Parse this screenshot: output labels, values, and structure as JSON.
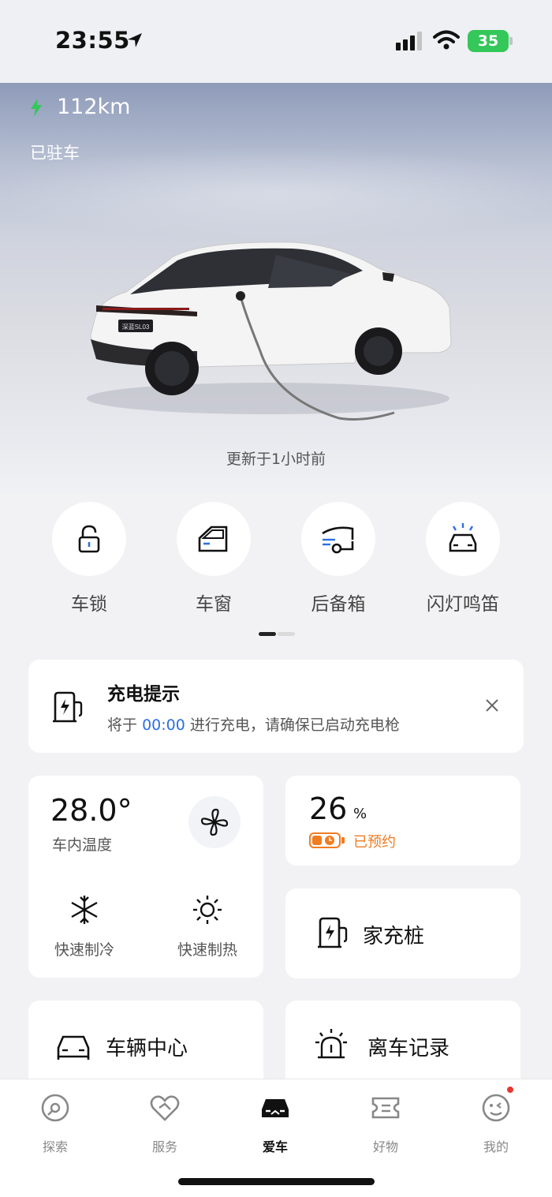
{
  "status_bar": {
    "time": "23:55",
    "battery": "35"
  },
  "hero": {
    "range": "112km",
    "status": "已驻车",
    "car_badge": "深蓝SL03",
    "updated": "更新于1小时前"
  },
  "controls": [
    {
      "label": "车锁",
      "icon": "lock-icon"
    },
    {
      "label": "车窗",
      "icon": "window-icon"
    },
    {
      "label": "后备箱",
      "icon": "trunk-icon"
    },
    {
      "label": "闪灯鸣笛",
      "icon": "flash-horn-icon"
    }
  ],
  "notice": {
    "title": "充电提示",
    "prefix": "将于",
    "time": "00:00",
    "suffix": "进行充电，请确保已启动充电枪"
  },
  "climate": {
    "temperature": "28.0°",
    "label": "车内温度",
    "quick_cool": "快速制冷",
    "quick_heat": "快速制热"
  },
  "battery_card": {
    "value": "26",
    "unit": "%",
    "status": "已预约"
  },
  "home_charger": {
    "label": "家充桩"
  },
  "vehicle_center": {
    "label": "车辆中心"
  },
  "leave_record": {
    "label": "离车记录"
  },
  "tabs": [
    {
      "label": "探索",
      "icon": "explore-icon"
    },
    {
      "label": "服务",
      "icon": "service-icon"
    },
    {
      "label": "爱车",
      "icon": "car-icon"
    },
    {
      "label": "好物",
      "icon": "shop-icon"
    },
    {
      "label": "我的",
      "icon": "profile-icon"
    }
  ],
  "colors": {
    "accent_blue": "#2c6fe0",
    "accent_orange": "#f07c22",
    "charge_green": "#34c759",
    "notification_red": "#e8382f"
  }
}
